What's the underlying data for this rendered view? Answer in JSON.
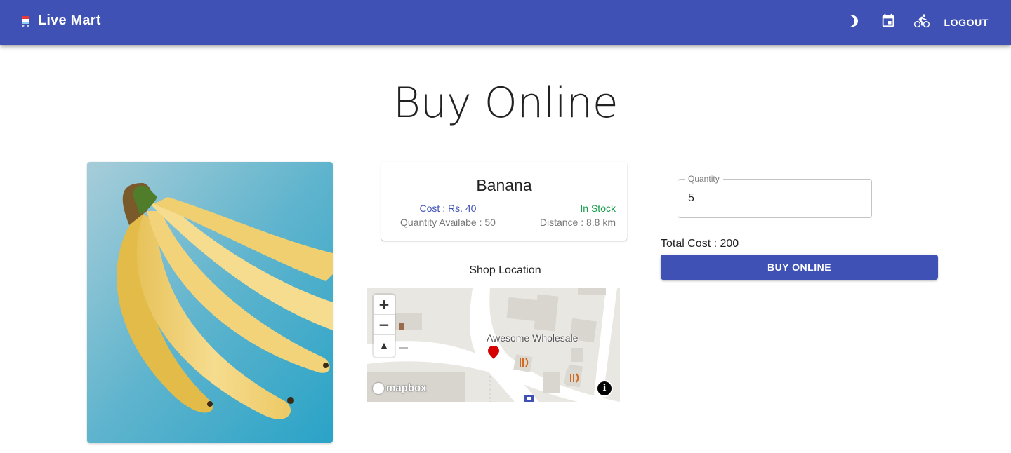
{
  "header": {
    "title": "Live Mart",
    "logout_label": "LOGOUT",
    "icons": [
      "cart-logo-icon",
      "dark-mode-icon",
      "calendar-icon",
      "delivery-bike-icon"
    ],
    "color": "#3f51b5"
  },
  "page": {
    "title": "Buy Online"
  },
  "product": {
    "name": "Banana",
    "cost": "Cost : Rs. 40",
    "stock_status": "In Stock",
    "quantity_available": "Quantity Availabe : 50",
    "distance": "Distance : 8.8 km"
  },
  "map": {
    "heading": "Shop Location",
    "place_label": "Awesome Wholesale",
    "zoom_in": "+",
    "zoom_out": "−",
    "compass": "▲",
    "attribution_logo": "mapbox",
    "info": "i"
  },
  "order": {
    "quantity_label": "Quantity",
    "quantity_value": "5",
    "total_cost": "Total Cost : 200",
    "buy_label": "BUY ONLINE"
  }
}
